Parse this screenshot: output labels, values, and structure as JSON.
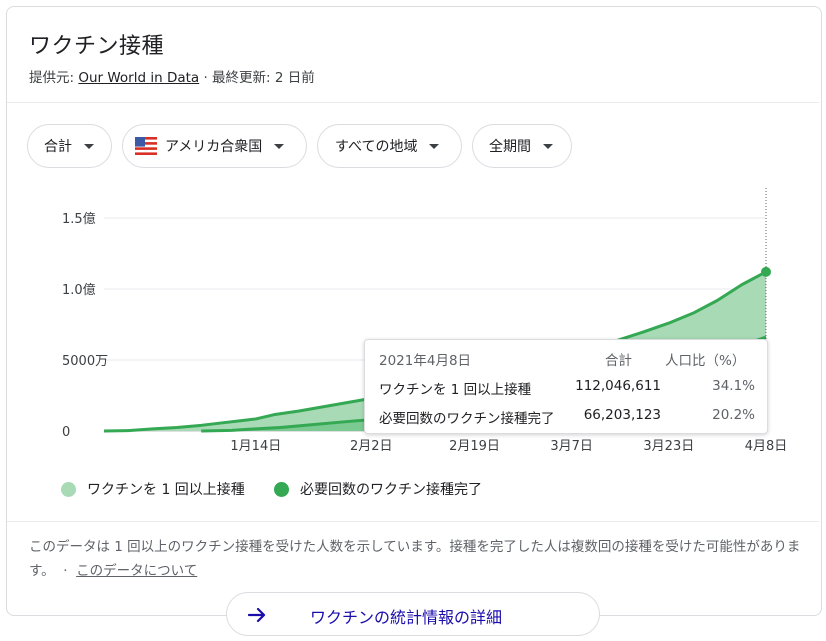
{
  "header": {
    "title": "ワクチン接種",
    "source_prefix": "提供元: ",
    "source_link": "Our World in Data",
    "updated": " · 最終更新: 2 日前"
  },
  "filters": {
    "measure": "合計",
    "country": "アメリカ合衆国",
    "region": "すべての地域",
    "period": "全期間"
  },
  "tooltip": {
    "date": "2021年4月8日",
    "col_total": "合計",
    "col_pct": "人口比（%）",
    "rows": [
      {
        "label": "ワクチンを 1 回以上接種",
        "total": "112,046,611",
        "pct": "34.1%"
      },
      {
        "label": "必要回数のワクチン接種完了",
        "total": "66,203,123",
        "pct": "20.2%"
      }
    ]
  },
  "legend": {
    "first": "ワクチンを 1 回以上接種",
    "full": "必要回数のワクチン接種完了"
  },
  "note": {
    "text": "このデータは 1 回以上のワクチン接種を受けた人数を示しています。接種を完了した人は複数回の接種を受けた可能性があります。",
    "link": "このデータについて"
  },
  "more_button": {
    "label": "ワクチンの統計情報の詳細"
  },
  "colors": {
    "first_dose": "#a8dab5",
    "full": "#34a853",
    "full_fill": "#6cc486",
    "grid": "#e8eaed"
  },
  "chart_data": {
    "type": "area",
    "ylim": [
      0,
      150000000
    ],
    "y_ticks": [
      {
        "value": 0,
        "label": "0"
      },
      {
        "value": 50000000,
        "label": "5000万"
      },
      {
        "value": 100000000,
        "label": "1.0億"
      },
      {
        "value": 150000000,
        "label": "1.5億"
      }
    ],
    "x_range": [
      "2020-12-20",
      "2021-04-08"
    ],
    "x_ticks": [
      {
        "date": "2021-01-14",
        "label": "1月14日"
      },
      {
        "date": "2021-02-02",
        "label": "2月2日"
      },
      {
        "date": "2021-02-19",
        "label": "2月19日"
      },
      {
        "date": "2021-03-07",
        "label": "3月7日"
      },
      {
        "date": "2021-03-23",
        "label": "3月23日"
      },
      {
        "date": "2021-04-08",
        "label": "4月8日"
      }
    ],
    "series": [
      {
        "name": "ワクチンを 1 回以上接種",
        "points": [
          [
            "2020-12-20",
            0
          ],
          [
            "2020-12-24",
            300000
          ],
          [
            "2020-12-28",
            1500000
          ],
          [
            "2021-01-01",
            2500000
          ],
          [
            "2021-01-05",
            4000000
          ],
          [
            "2021-01-08",
            5500000
          ],
          [
            "2021-01-12",
            7500000
          ],
          [
            "2021-01-14",
            8500000
          ],
          [
            "2021-01-17",
            11500000
          ],
          [
            "2021-01-21",
            14000000
          ],
          [
            "2021-01-25",
            17000000
          ],
          [
            "2021-01-29",
            20000000
          ],
          [
            "2021-02-02",
            23000000
          ],
          [
            "2021-02-06",
            26000000
          ],
          [
            "2021-02-10",
            28500000
          ],
          [
            "2021-02-14",
            31500000
          ],
          [
            "2021-02-19",
            35000000
          ],
          [
            "2021-02-23",
            38500000
          ],
          [
            "2021-02-27",
            42500000
          ],
          [
            "2021-03-03",
            47000000
          ],
          [
            "2021-03-07",
            52500000
          ],
          [
            "2021-03-11",
            58500000
          ],
          [
            "2021-03-15",
            64500000
          ],
          [
            "2021-03-19",
            70000000
          ],
          [
            "2021-03-23",
            76000000
          ],
          [
            "2021-03-27",
            83000000
          ],
          [
            "2021-03-31",
            92000000
          ],
          [
            "2021-04-04",
            103000000
          ],
          [
            "2021-04-08",
            112046611
          ]
        ]
      },
      {
        "name": "必要回数のワクチン接種完了",
        "points": [
          [
            "2021-01-05",
            0
          ],
          [
            "2021-01-10",
            400000
          ],
          [
            "2021-01-14",
            1500000
          ],
          [
            "2021-01-18",
            2500000
          ],
          [
            "2021-01-22",
            4000000
          ],
          [
            "2021-01-26",
            5500000
          ],
          [
            "2021-01-30",
            7000000
          ],
          [
            "2021-02-02",
            8000000
          ],
          [
            "2021-02-06",
            10000000
          ],
          [
            "2021-02-10",
            12000000
          ],
          [
            "2021-02-14",
            14000000
          ],
          [
            "2021-02-19",
            16500000
          ],
          [
            "2021-02-24",
            20000000
          ],
          [
            "2021-03-01",
            24000000
          ],
          [
            "2021-03-07",
            30000000
          ],
          [
            "2021-03-11",
            34500000
          ],
          [
            "2021-03-15",
            38000000
          ],
          [
            "2021-03-19",
            42000000
          ],
          [
            "2021-03-23",
            45500000
          ],
          [
            "2021-03-27",
            49500000
          ],
          [
            "2021-03-31",
            54000000
          ],
          [
            "2021-04-04",
            60000000
          ],
          [
            "2021-04-08",
            66203123
          ]
        ]
      }
    ],
    "grid": true,
    "legend_position": "bottom-left"
  }
}
